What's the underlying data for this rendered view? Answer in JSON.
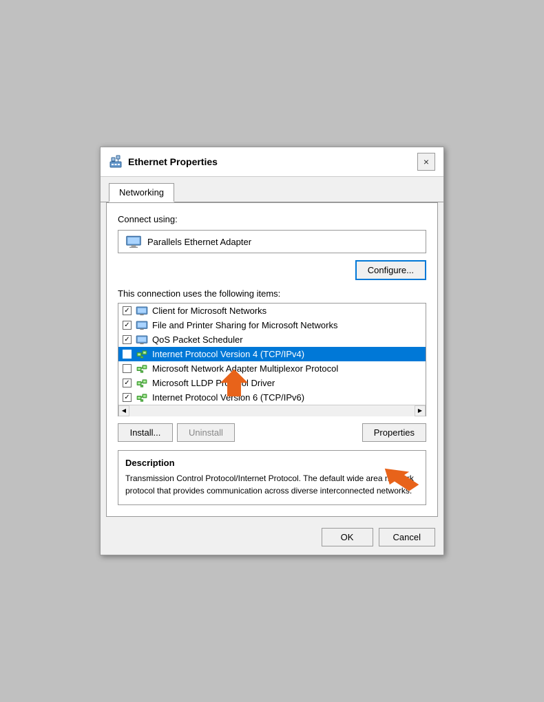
{
  "dialog": {
    "title": "Ethernet Properties",
    "close_label": "×",
    "tab_networking": "Networking",
    "connect_using_label": "Connect using:",
    "adapter_name": "Parallels Ethernet Adapter",
    "configure_label": "Configure...",
    "connection_items_label": "This connection uses the following items:",
    "items": [
      {
        "id": "client-ms-networks",
        "checked": true,
        "label": "Client for Microsoft Networks",
        "icon_type": "network"
      },
      {
        "id": "file-printer-sharing",
        "checked": true,
        "label": "File and Printer Sharing for Microsoft Networks",
        "icon_type": "network"
      },
      {
        "id": "qos-scheduler",
        "checked": true,
        "label": "QoS Packet Scheduler",
        "icon_type": "network"
      },
      {
        "id": "ipv4",
        "checked": true,
        "label": "Internet Protocol Version 4 (TCP/IPv4)",
        "icon_type": "green",
        "selected": true
      },
      {
        "id": "ms-network-adapter",
        "checked": false,
        "label": "Microsoft Network Adapter Multiplexor Protocol",
        "icon_type": "green"
      },
      {
        "id": "ms-lldp",
        "checked": true,
        "label": "Microsoft LLDP Protocol Driver",
        "icon_type": "green"
      },
      {
        "id": "ipv6",
        "checked": true,
        "label": "Internet Protocol Version 6 (TCP/IPv6)",
        "icon_type": "green"
      }
    ],
    "install_label": "Install...",
    "uninstall_label": "Uninstall",
    "properties_label": "Properties",
    "description_title": "Description",
    "description_text": "Transmission Control Protocol/Internet Protocol. The default wide area network protocol that provides communication across diverse interconnected networks.",
    "ok_label": "OK",
    "cancel_label": "Cancel"
  }
}
